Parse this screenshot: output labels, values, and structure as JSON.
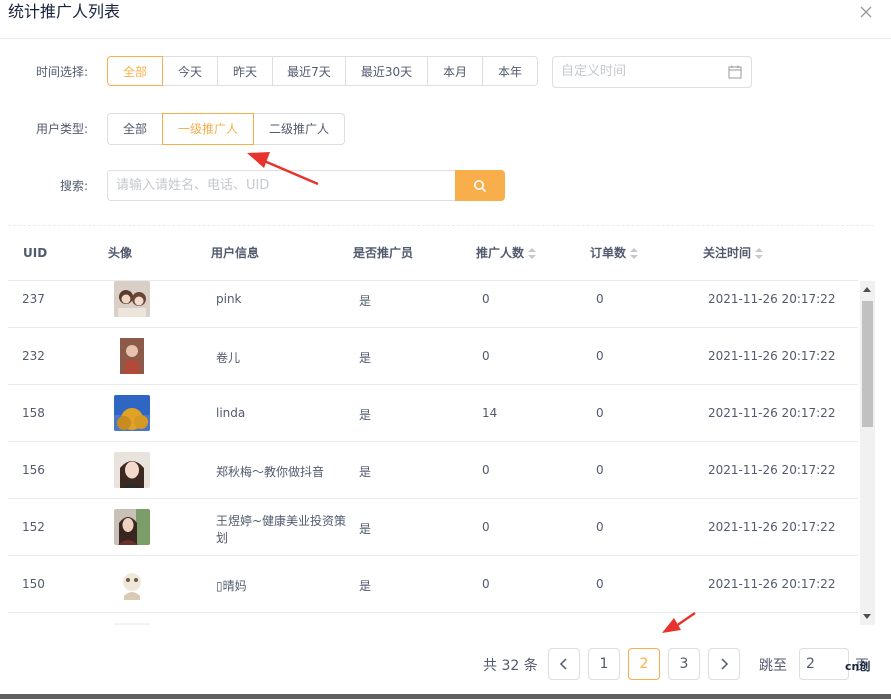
{
  "modal": {
    "title": "统计推广人列表",
    "close_icon": "close-icon"
  },
  "filters": {
    "time_label": "时间选择:",
    "time_options": [
      "全部",
      "今天",
      "昨天",
      "最近7天",
      "最近30天",
      "本月",
      "本年"
    ],
    "time_active": "全部",
    "date_placeholder": "自定义时间",
    "user_type_label": "用户类型:",
    "user_type_options": [
      "全部",
      "一级推广人",
      "二级推广人"
    ],
    "user_type_active": "一级推广人",
    "search_label": "搜索:",
    "search_placeholder": "请输入请姓名、电话、UID"
  },
  "table": {
    "columns": [
      "UID",
      "头像",
      "用户信息",
      "是否推广员",
      "推广人数",
      "订单数",
      "关注时间"
    ],
    "rows": [
      {
        "uid": "237",
        "name": "pink",
        "name2": "",
        "is_promoter": "是",
        "promoted": "0",
        "orders": "0",
        "followed": "2021-11-26 20:17:22"
      },
      {
        "uid": "232",
        "name": "卷儿",
        "name2": "",
        "is_promoter": "是",
        "promoted": "0",
        "orders": "0",
        "followed": "2021-11-26 20:17:22"
      },
      {
        "uid": "158",
        "name": "linda",
        "name2": "",
        "is_promoter": "是",
        "promoted": "14",
        "orders": "0",
        "followed": "2021-11-26 20:17:22"
      },
      {
        "uid": "156",
        "name": "郑秋梅～教你做抖音",
        "name2": "",
        "is_promoter": "是",
        "promoted": "0",
        "orders": "0",
        "followed": "2021-11-26 20:17:22"
      },
      {
        "uid": "152",
        "name": "王煜婷~健康美业投资策",
        "name2": "划",
        "is_promoter": "是",
        "promoted": "0",
        "orders": "0",
        "followed": "2021-11-26 20:17:22"
      },
      {
        "uid": "150",
        "name": "▯晴妈",
        "name2": "",
        "is_promoter": "是",
        "promoted": "0",
        "orders": "0",
        "followed": "2021-11-26 20:17:22"
      }
    ]
  },
  "pagination": {
    "total_text": "共 32 条",
    "pages": [
      "1",
      "2",
      "3"
    ],
    "current": "2",
    "jump_label": "跳至",
    "jump_value": "2",
    "jump_suffix": "页"
  },
  "watermark": "cn创",
  "colors": {
    "accent": "#f8ae4a",
    "arrow": "#e8322d",
    "border": "#dcdee2"
  }
}
